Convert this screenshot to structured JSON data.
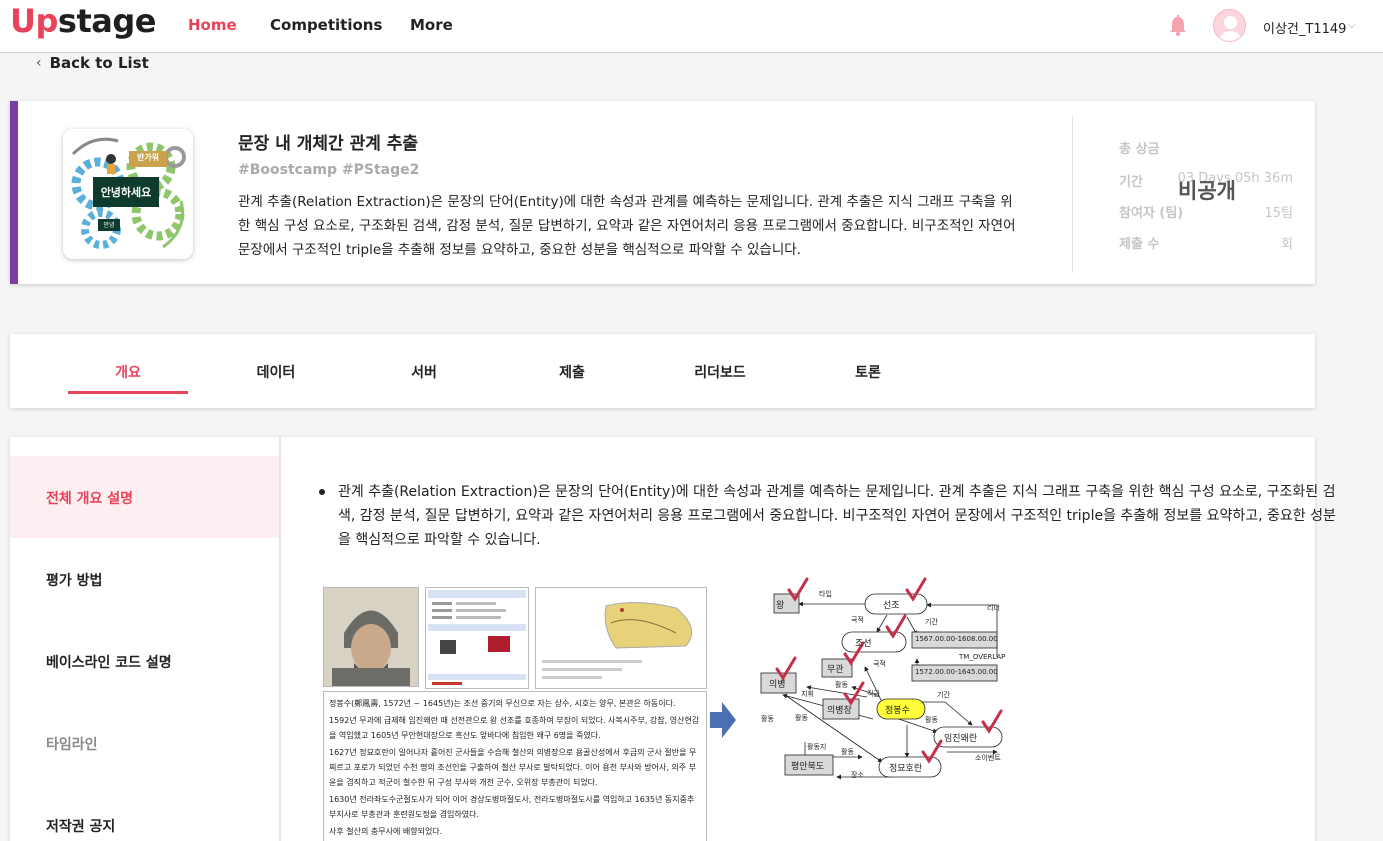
{
  "nav": {
    "logo_up": "Up",
    "logo_rest": "stage",
    "links": [
      "Home",
      "Competitions",
      "More"
    ],
    "username": "이상건_T1149",
    "user_chev": "⌵"
  },
  "back": {
    "label": "Back to List"
  },
  "competition": {
    "title": "문장 내 개체간 관계 추출",
    "tags": "#Boostcamp #PStage2",
    "description": "관계 추출(Relation Extraction)은 문장의 단어(Entity)에 대한 속성과 관계를 예측하는 문제입니다. 관계 추출은 지식 그래프 구축을 위한 핵심 구성 요소로, 구조화된 검색, 감정 분석, 질문 답변하기, 요약과 같은 자연어처리 응용 프로그램에서 중요합니다. 비구조적인 자연어 문장에서 구조적인 triple을 추출해 정보를 요약하고, 중요한 성분을 핵심적으로 파악할 수 있습니다.",
    "thumb_greeting": "안녕하세요",
    "thumb_small1": "반가워",
    "thumb_small2": "안녕",
    "stats": {
      "prize_label": "총 상금",
      "period_label": "기간",
      "period_value": "03 Days 05h 36m",
      "participants_label": "참여자 (팀)",
      "participants_value": "15팀",
      "submissions_label": "제출 수",
      "submissions_value": "회",
      "private_label": "비공개"
    }
  },
  "tabs": [
    "개요",
    "데이터",
    "서버",
    "제출",
    "리더보드",
    "토론"
  ],
  "sidebar": [
    "전체 개요 설명",
    "평가 방법",
    "베이스라인 코드 설명",
    "타임라인",
    "저작권 공지"
  ],
  "overview": {
    "text": "관계 추출(Relation Extraction)은 문장의 단어(Entity)에 대한 속성과 관계를 예측하는 문제입니다. 관계 추출은 지식 그래프 구축을 위한 핵심 구성 요소로, 구조화된 검색, 감정 분석, 질문 답변하기, 요약과 같은 자연어처리 응용 프로그램에서 중요합니다. 비구조적인 자연어 문장에서 구조적인 triple을 추출해 정보를 요약하고, 중요한 성분을 핵심적으로 파악할 수 있습니다."
  },
  "figure": {
    "wiki_lines": [
      "정봉수(鄭鳳壽, 1572년 ~ 1645년)는 조선 중기의 무신으로 자는 상수, 시호는 양무, 본관은 하동이다.",
      "1592년 무과에 급제해 임진왜란 때 선전관으로 왕 선조를 호종하여 부장이 되었다. 사복시주부, 강참, 영산현감을 역임했고 1605년 무안현대장으로 흑산도 앞바다에 침입한 왜구 6명을 죽였다.",
      "1627년 정묘호란이 일어나자 흩어진 군사들을 수습해 철산의 의병장으로 용골산성에서 후금의 군사 절반을 무찌르고 포로가 되었던 수천 명의 조선인을 구출하여 철산 부사로 발탁되었다. 이어 용천 부사와 방어사, 의주 부윤을 겸직하고 적군이 철수한 뒤 구성 부사와 개천 군수, 오위장 부총관이 되었다.",
      "1630년 전라좌도수군절도사가 되어 이어 경상도병마절도사, 전라도병마절도사를 역임하고 1635년 동지중추부지사로 부총관과 훈련원도정을 겸임하였다.",
      "사후 철산의 충무사에 배향되었다."
    ],
    "nodes": {
      "wang": "왕",
      "seonjo": "선조",
      "joseon": "조선",
      "mugwan": "무관",
      "uibyeong": "의병",
      "uibyeongjang": "의병장",
      "jeongbongsu": "정봉수",
      "imjin": "임진왜란",
      "jeongmyo": "정묘호란",
      "pyeongan": "평안북도",
      "date1": "1567.00.00-1608.00.00",
      "date2": "1572.00.00-1645.00.00"
    },
    "edges": {
      "taip": "타입",
      "gukjeok": "국적",
      "gigan": "기간",
      "rideo": "리더",
      "gukjeok2": "국적",
      "tm": "TM_OVERLAP",
      "hwaldong1": "활동",
      "jikeup": "직급",
      "jihwi": "지휘",
      "hwaldong2": "활동",
      "hwaldong3": "활동",
      "gigan2": "기간",
      "hwaldong4": "활동",
      "hwaldongji": "활동지",
      "hwaldong5": "활동",
      "sasobenteu": "소이벤트",
      "jangso": "장소"
    }
  },
  "colors": {
    "accent": "#e8435a",
    "purple": "#7a3fa0"
  }
}
